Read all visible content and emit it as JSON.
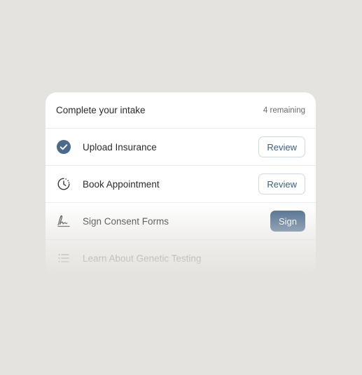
{
  "card": {
    "title": "Complete your intake",
    "remaining": "4 remaining"
  },
  "tasks": [
    {
      "label": "Upload Insurance",
      "action": "Review",
      "icon": "check-circle-icon",
      "status": "done"
    },
    {
      "label": "Book Appointment",
      "action": "Review",
      "icon": "clock-icon",
      "status": "done"
    },
    {
      "label": "Sign Consent Forms",
      "action": "Sign",
      "icon": "signature-icon",
      "status": "current"
    },
    {
      "label": "Learn About Genetic Testing",
      "icon": "list-icon",
      "status": "pending"
    }
  ],
  "colors": {
    "background": "#e5e3df",
    "accent": "#4a6a8d",
    "accent_text": "#3c5f82"
  }
}
